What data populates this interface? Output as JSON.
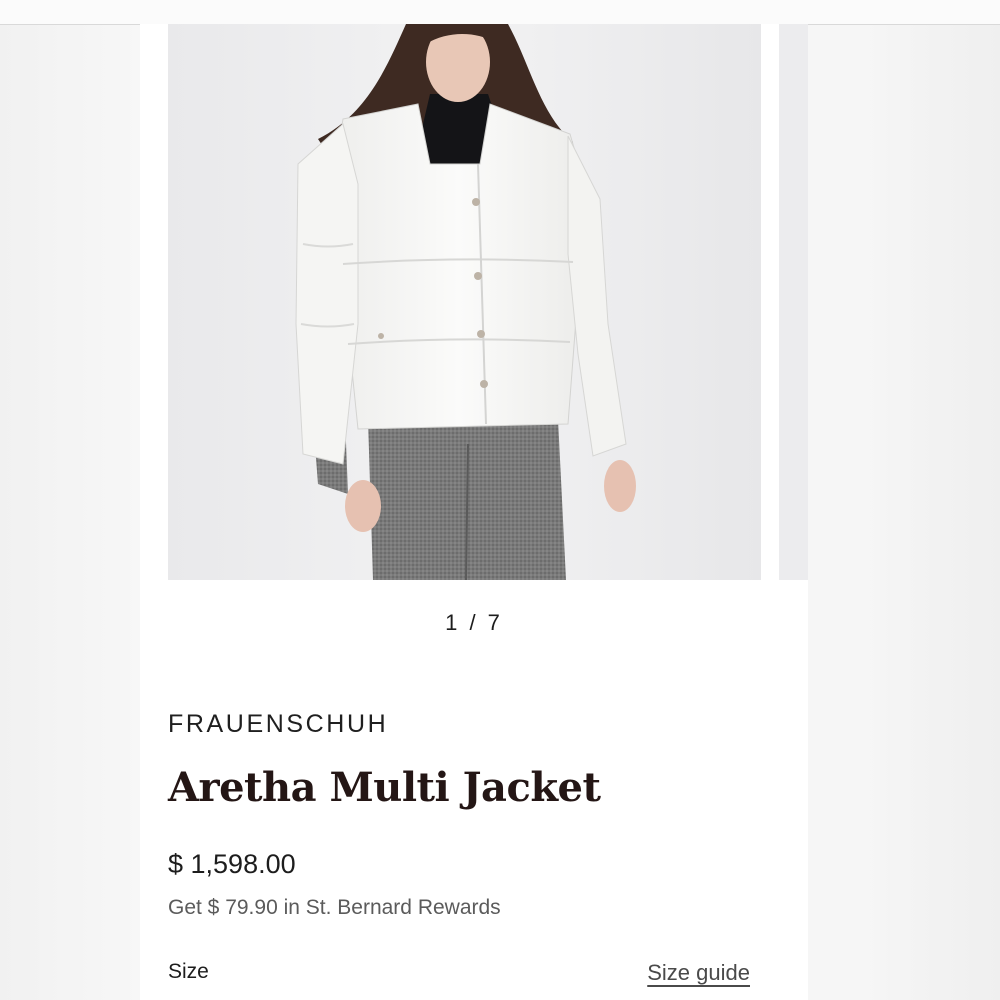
{
  "gallery": {
    "image_alt": "Aretha Multi Jacket",
    "current": 1,
    "total": 7,
    "indicator_text": "1 / 7"
  },
  "product": {
    "brand": "FRAUENSCHUH",
    "name": "Aretha Multi Jacket",
    "price": "$ 1,598.00",
    "rewards_text": "Get $ 79.90 in St. Bernard Rewards"
  },
  "size": {
    "label": "Size",
    "guide_link": "Size guide"
  },
  "colors": {
    "title_text": "#241615",
    "background": "#ffffff",
    "image_bg": "#ebebed"
  }
}
